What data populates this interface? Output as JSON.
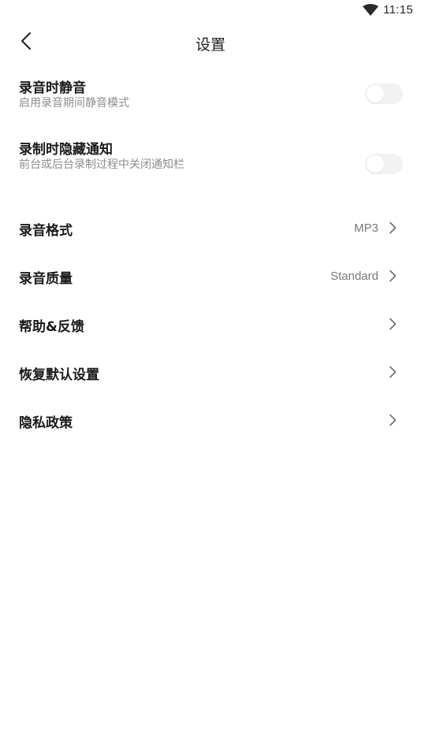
{
  "status_bar": {
    "time": "11:15"
  },
  "header": {
    "title": "设置"
  },
  "toggles": [
    {
      "title": "录音时静音",
      "subtitle": "启用录音期间静音模式",
      "enabled": false
    },
    {
      "title": "录制时隐藏通知",
      "subtitle": "前台或后台录制过程中关闭通知栏",
      "enabled": false
    }
  ],
  "nav_items": [
    {
      "label": "录音格式",
      "value": "MP3"
    },
    {
      "label": "录音质量",
      "value": "Standard"
    },
    {
      "label": "帮助&反馈",
      "value": ""
    },
    {
      "label": "恢复默认设置",
      "value": ""
    },
    {
      "label": "隐私政策",
      "value": ""
    }
  ],
  "colors": {
    "switch_off_track": "#f2f2f2",
    "secondary_text": "#8e8e8e",
    "primary_text": "#1a1a1a"
  }
}
